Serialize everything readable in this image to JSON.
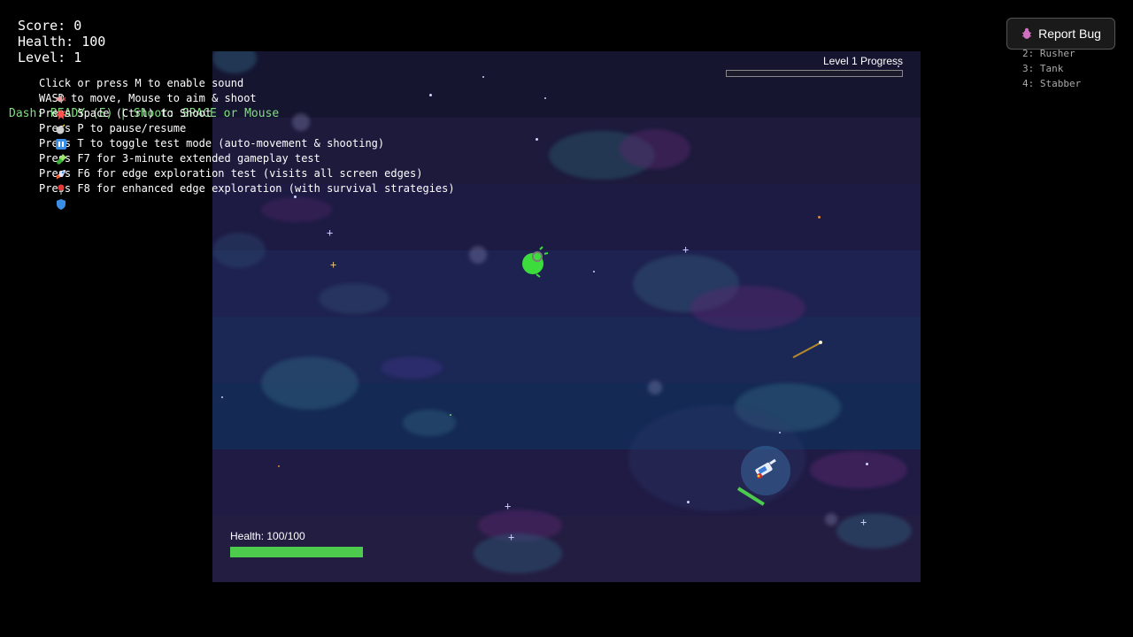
{
  "hud": {
    "score": "Score: 0",
    "health": "Health: 100",
    "level": "Level: 1"
  },
  "instructions": [
    {
      "icon": "speaker-muted-icon",
      "text": "Click or press M to enable sound"
    },
    {
      "icon": "explosion-icon",
      "text": "WASD to move, Mouse to aim & shoot"
    },
    {
      "icon": "bomb-icon",
      "text": "Press Space (Ctrl) to Shoot"
    },
    {
      "icon": "pause-icon",
      "text": "Press P to pause/resume"
    },
    {
      "icon": "test-tube-icon",
      "text": "Press T to toggle test mode (auto-movement & shooting)"
    },
    {
      "icon": "rocket-icon",
      "text": "Press F7 for 3-minute extended gameplay test"
    },
    {
      "icon": "pin-icon",
      "text": "Press F6 for edge exploration test (visits all screen edges)"
    },
    {
      "icon": "shield-icon",
      "text": "Press F8 for enhanced edge exploration (with survival strategies)"
    }
  ],
  "dash_status": "Dash: READY (E) | Shoot: SPACE or Mouse",
  "level_progress": {
    "label": "Level 1 Progress",
    "fraction": 0.0
  },
  "player_health": {
    "label": "Health: 100/100",
    "fraction": 1.0
  },
  "enemy_types": [
    "2: Rusher",
    "3: Tank",
    "4: Stabber"
  ],
  "report_bug": {
    "icon": "bug-icon",
    "label": "Report Bug"
  },
  "colors": {
    "health_bar": "#4ccb4c",
    "dash_text": "#7fe07f",
    "enemy": "#3ddc3d",
    "player_shield": "#3a7bd5"
  }
}
